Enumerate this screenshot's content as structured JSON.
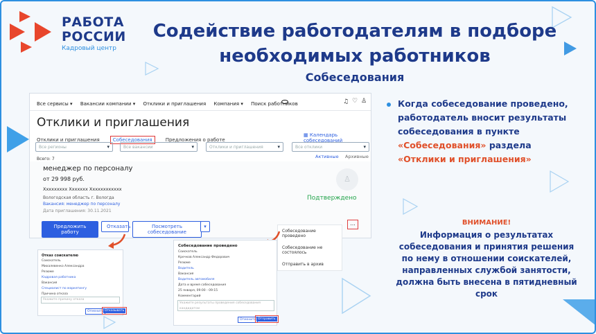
{
  "logo": {
    "line1": "РАБОТА",
    "line2": "РОССИИ",
    "sub": "Кадровый центр"
  },
  "title": {
    "line1": "Содействие  работодателям в подборе",
    "line2": "необходимых работников"
  },
  "subtitle": "Собеседования",
  "screen": {
    "nav": [
      "Все сервисы ▾",
      "Вакансии компании ▾",
      "Отклики и приглашения",
      "Компания ▾",
      "Поиск работников"
    ],
    "nav_icons": [
      "eye-icon",
      "bell-icon",
      "heart-icon",
      "user-icon"
    ],
    "heading": "Отклики и приглашения",
    "tabs": [
      "Отклики и приглашения",
      "Собеседования",
      "Предложения о работе"
    ],
    "calendar_link": "Календарь собеседований",
    "filters": [
      "Все регионы",
      "Все вакансии",
      "Отклики и приглашения",
      "Все отклики"
    ],
    "total": "Всего: 7",
    "toggle": [
      "Активные",
      "Архивные"
    ],
    "card": {
      "position": "менеджер по персоналу",
      "salary": "от 29 998 руб.",
      "name": "Xxxxxxxxx Xxxxxxx Xxxxxxxxxxxx",
      "location": "Вологодская область г. Вологда",
      "vacancy": "Вакансия: менеджер по персоналу",
      "date": "Дата приглашения: 30.11.2021",
      "status": "Подтверждено"
    },
    "buttons": {
      "offer": "Предложить работу",
      "reject": "Отказать",
      "view": "Посмотреть собеседование",
      "more": "..."
    },
    "menu": [
      "Собеседование проведено",
      "Собеседование не состоялось",
      "Отправить в архив"
    ]
  },
  "form1": {
    "title": "Отказ соискателю",
    "f1_label": "Соискатель",
    "f1_val": "Михалевенко Александра",
    "f2_label": "Резюме",
    "f2_val": "Кадровая работника",
    "f3_label": "Вакансия",
    "f3_val": "Специалист по маркетингу",
    "f4_label": "Причина отказа",
    "placeholder": "Укажите причину отказа",
    "cancel": "Отменить",
    "submit": "Отказывать"
  },
  "form2": {
    "title": "Собеседование проведено",
    "f1_label": "Соискатель",
    "f1_val": "Кречков Александр Федорович",
    "f2_label": "Резюме",
    "f2_val": "Водитель",
    "f3_label": "Вакансия",
    "f3_val": "Водитель автомобиля",
    "f4_label": "Дата и время собеседования",
    "f4_val": "25 января, 09:00 - 09:15",
    "f5_label": "Комментарий",
    "placeholder": "Укажите результаты проведения собеседования кандидатом",
    "cancel": "Отменить",
    "submit": "Отправить"
  },
  "bullet": {
    "p1": "Когда собеседование проведено, работодатель вносит результаты собеседования в пункте",
    "p2": "«Собеседования»",
    "p3": " раздела",
    "p4": "«Отклики и приглашения»"
  },
  "warning": {
    "head": "ВНИМАНИЕ!",
    "body": "Информация о результатах собеседования и принятия решения по нему  в отношении соискателей, направленных службой занятости, должна быть внесена в пятидневный срок"
  },
  "colors": {
    "brand": "#1e3a8a",
    "accent": "#2d8fe0",
    "red": "#e0502a",
    "logo_red": "#e8462c"
  }
}
